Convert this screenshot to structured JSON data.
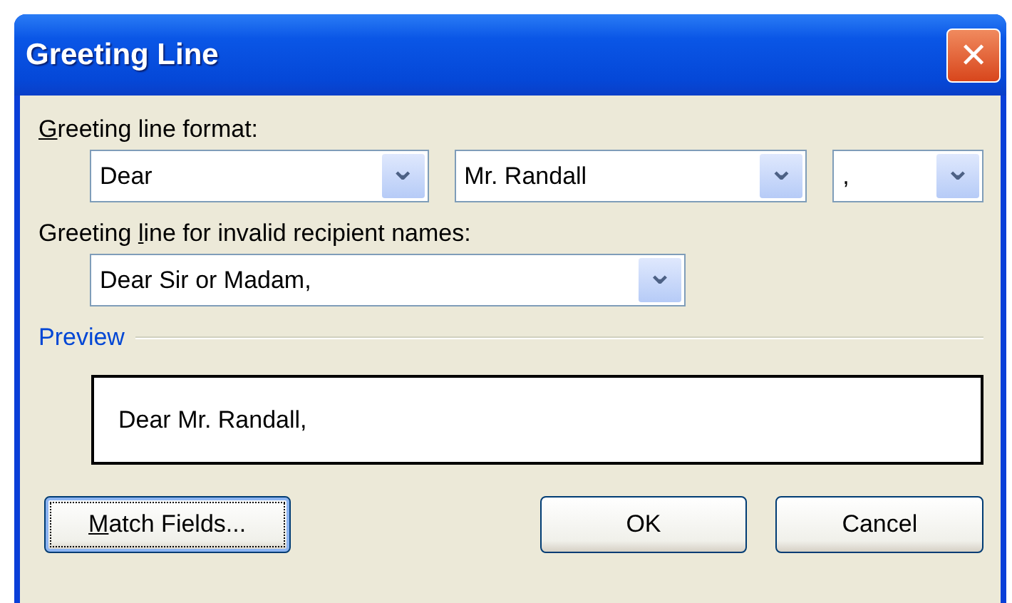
{
  "window": {
    "title": "Greeting Line",
    "close": "✕"
  },
  "format": {
    "label": {
      "key": "G",
      "after": "reeting line format:"
    },
    "combos": [
      {
        "value": "Dear",
        "arrow": "⌄"
      },
      {
        "value": "Mr. Randall",
        "arrow": "⌄"
      },
      {
        "value": ",",
        "arrow": "⌄"
      }
    ]
  },
  "invalid": {
    "label": {
      "before": "Greeting ",
      "key": "l",
      "after": "ine for invalid recipient names:"
    },
    "combo": {
      "value": "Dear Sir or Madam,",
      "arrow": "⌄"
    }
  },
  "preview": {
    "label": "Preview",
    "text": "Dear Mr. Randall,"
  },
  "buttons": [
    {
      "label": {
        "key": "M",
        "after": "atch Fields..."
      },
      "focused": true,
      "kind": "left"
    },
    {
      "label": {
        "after": "OK"
      },
      "focused": false,
      "kind": "right"
    },
    {
      "label": {
        "after": "Cancel"
      },
      "focused": false,
      "kind": "right"
    }
  ]
}
